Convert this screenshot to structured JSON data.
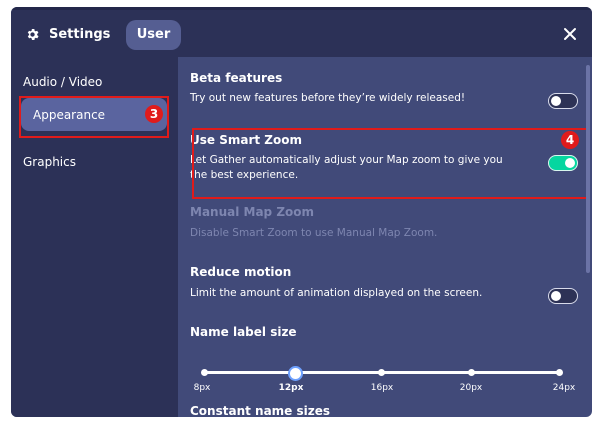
{
  "header": {
    "settings_label": "Settings",
    "tab_user_label": "User",
    "icons": {
      "settings": "gear-icon",
      "close": "close-icon"
    }
  },
  "sidebar": {
    "items": [
      {
        "label": "Audio / Video"
      },
      {
        "label": "Appearance",
        "active": true
      },
      {
        "label": "Graphics"
      }
    ]
  },
  "annotations": {
    "badge_3": "3",
    "badge_4": "4"
  },
  "content": {
    "beta": {
      "title": "Beta features",
      "desc": "Try out new features before they’re widely released!",
      "enabled": false
    },
    "smart_zoom": {
      "title": "Use Smart Zoom",
      "desc": "Let Gather automatically adjust your Map zoom to give you the best experience.",
      "enabled": true
    },
    "manual_zoom": {
      "title": "Manual Map Zoom",
      "desc": "Disable Smart Zoom to use Manual Map Zoom."
    },
    "reduce_motion": {
      "title": "Reduce motion",
      "desc": "Limit the amount of animation displayed on the screen.",
      "enabled": false
    },
    "name_label": {
      "title": "Name label size",
      "ticks": [
        "8px",
        "12px",
        "16px",
        "20px",
        "24px"
      ],
      "selected": "12px"
    },
    "constant_sizes": {
      "title": "Constant name sizes"
    }
  },
  "colors": {
    "panel": "#414a79",
    "header": "#2c3157",
    "active_item": "#5a649f",
    "toggle_on": "#06d6a0",
    "annotation_red": "#e01b1b"
  }
}
